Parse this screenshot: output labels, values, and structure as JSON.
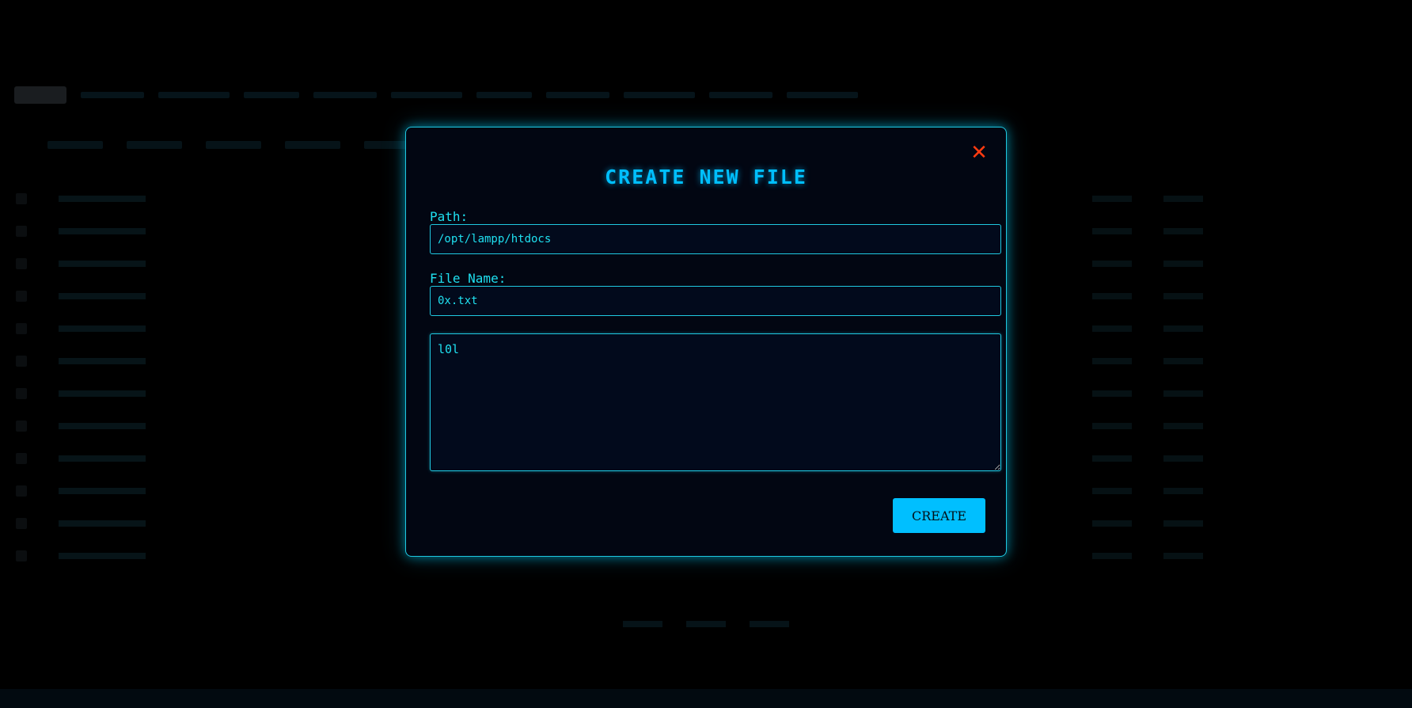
{
  "modal": {
    "title": "CREATE NEW FILE",
    "close_symbol": "✕",
    "path_label": "Path:",
    "path_value": "/opt/lampp/htdocs",
    "filename_label": "File Name:",
    "filename_value": "0x.txt",
    "content_value": "l0l",
    "create_label": "CREATE"
  },
  "colors": {
    "accent": "#00bfff",
    "border": "#1fc8e0",
    "close": "#ff3b10",
    "panel_bg": "#020612"
  },
  "icons": {
    "close": "close-icon"
  }
}
